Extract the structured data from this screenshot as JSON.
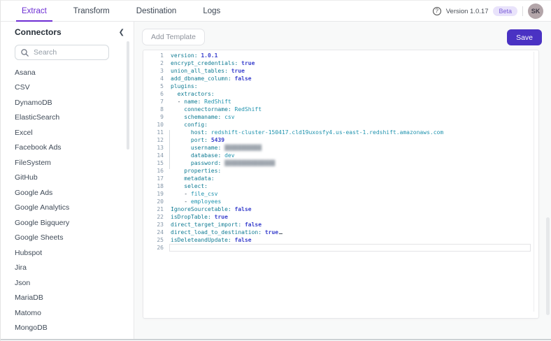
{
  "colors": {
    "accent_purple": "#6d2ed3",
    "save_button": "#4a32c3",
    "beta_badge_bg": "#e9e3fb",
    "beta_badge_text": "#7a5cd8",
    "avatar_bg": "#b3a5a9",
    "syntax_key": "#0f7b93",
    "syntax_string": "#2093ae",
    "syntax_literal": "#3a41cd"
  },
  "header": {
    "tabs": [
      {
        "label": "Extract",
        "active": true
      },
      {
        "label": "Transform",
        "active": false
      },
      {
        "label": "Destination",
        "active": false
      },
      {
        "label": "Logs",
        "active": false
      }
    ],
    "help_icon": "?",
    "version": "Version 1.0.17",
    "beta_badge": "Beta",
    "avatar_initials": "SK"
  },
  "sidebar": {
    "title": "Connectors",
    "collapse_icon": "❮",
    "search_placeholder": "Search",
    "items": [
      "Asana",
      "CSV",
      "DynamoDB",
      "ElasticSearch",
      "Excel",
      "Facebook Ads",
      "FileSystem",
      "GitHub",
      "Google Ads",
      "Google Analytics",
      "Google Bigquery",
      "Google Sheets",
      "Hubspot",
      "Jira",
      "Json",
      "MariaDB",
      "Matomo",
      "MongoDB"
    ]
  },
  "toolbar": {
    "add_template_label": "Add Template",
    "save_label": "Save"
  },
  "editor": {
    "language": "yaml",
    "lines": [
      {
        "num": 1,
        "segments": [
          {
            "text": "version: ",
            "style": "key"
          },
          {
            "text": "1.0.1",
            "style": "num"
          }
        ]
      },
      {
        "num": 2,
        "segments": [
          {
            "text": "encrypt_credentials: ",
            "style": "key"
          },
          {
            "text": "true",
            "style": "bool"
          }
        ]
      },
      {
        "num": 3,
        "segments": [
          {
            "text": "union_all_tables: ",
            "style": "key"
          },
          {
            "text": "true",
            "style": "bool"
          }
        ]
      },
      {
        "num": 4,
        "segments": [
          {
            "text": "add_dbname_column: ",
            "style": "key"
          },
          {
            "text": "false",
            "style": "bool"
          }
        ]
      },
      {
        "num": 5,
        "segments": [
          {
            "text": "plugins:",
            "style": "key"
          }
        ]
      },
      {
        "num": 6,
        "segments": [
          {
            "text": "  ",
            "style": "plain"
          },
          {
            "text": "extractors:",
            "style": "key"
          }
        ]
      },
      {
        "num": 7,
        "segments": [
          {
            "text": "  - ",
            "style": "plain"
          },
          {
            "text": "name: ",
            "style": "key"
          },
          {
            "text": "RedShift",
            "style": "str"
          }
        ]
      },
      {
        "num": 8,
        "segments": [
          {
            "text": "    ",
            "style": "plain"
          },
          {
            "text": "connectorname: ",
            "style": "key"
          },
          {
            "text": "RedShift",
            "style": "str"
          }
        ]
      },
      {
        "num": 9,
        "segments": [
          {
            "text": "    ",
            "style": "plain"
          },
          {
            "text": "schemaname: ",
            "style": "key"
          },
          {
            "text": "csv",
            "style": "str"
          }
        ]
      },
      {
        "num": 10,
        "segments": [
          {
            "text": "    ",
            "style": "plain"
          },
          {
            "text": "config:",
            "style": "key"
          }
        ]
      },
      {
        "num": 11,
        "segments": [
          {
            "text": "      ",
            "style": "plain"
          },
          {
            "text": "host: ",
            "style": "key"
          },
          {
            "text": "redshift-cluster-150417.cld19uxosfy4.us-east-1.redshift.amazonaws.com",
            "style": "str"
          }
        ]
      },
      {
        "num": 12,
        "segments": [
          {
            "text": "      ",
            "style": "plain"
          },
          {
            "text": "port: ",
            "style": "key"
          },
          {
            "text": "5439",
            "style": "num"
          }
        ]
      },
      {
        "num": 13,
        "segments": [
          {
            "text": "      ",
            "style": "plain"
          },
          {
            "text": "username: ",
            "style": "key"
          },
          {
            "text": "███████████",
            "style": "redacted"
          }
        ]
      },
      {
        "num": 14,
        "segments": [
          {
            "text": "      ",
            "style": "plain"
          },
          {
            "text": "database: ",
            "style": "key"
          },
          {
            "text": "dev",
            "style": "str"
          }
        ]
      },
      {
        "num": 15,
        "segments": [
          {
            "text": "      ",
            "style": "plain"
          },
          {
            "text": "password: ",
            "style": "key"
          },
          {
            "text": "███████████████",
            "style": "redacted"
          }
        ]
      },
      {
        "num": 16,
        "segments": [
          {
            "text": "    ",
            "style": "plain"
          },
          {
            "text": "properties:",
            "style": "key"
          }
        ]
      },
      {
        "num": 17,
        "segments": [
          {
            "text": "    ",
            "style": "plain"
          },
          {
            "text": "metadata:",
            "style": "key"
          }
        ]
      },
      {
        "num": 18,
        "segments": [
          {
            "text": "    ",
            "style": "plain"
          },
          {
            "text": "select:",
            "style": "key"
          }
        ]
      },
      {
        "num": 19,
        "segments": [
          {
            "text": "    - ",
            "style": "plain"
          },
          {
            "text": "file_csv",
            "style": "str"
          }
        ]
      },
      {
        "num": 20,
        "segments": [
          {
            "text": "    - ",
            "style": "plain"
          },
          {
            "text": "employees",
            "style": "str"
          }
        ]
      },
      {
        "num": 21,
        "segments": [
          {
            "text": "IgnoreSourcetable: ",
            "style": "key"
          },
          {
            "text": "false",
            "style": "bool"
          }
        ]
      },
      {
        "num": 22,
        "segments": [
          {
            "text": "isDropTable: ",
            "style": "key"
          },
          {
            "text": "true",
            "style": "bool"
          }
        ]
      },
      {
        "num": 23,
        "segments": [
          {
            "text": "direct_target_import: ",
            "style": "key"
          },
          {
            "text": "false",
            "style": "bool"
          }
        ]
      },
      {
        "num": 24,
        "segments": [
          {
            "text": "direct_load_to_destination: ",
            "style": "key"
          },
          {
            "text": "true",
            "style": "bool"
          }
        ],
        "cursor": true
      },
      {
        "num": 25,
        "segments": [
          {
            "text": "isDeleteandUpdate: ",
            "style": "key"
          },
          {
            "text": "false",
            "style": "bool"
          }
        ]
      },
      {
        "num": 26,
        "segments": [],
        "active": true
      }
    ]
  }
}
